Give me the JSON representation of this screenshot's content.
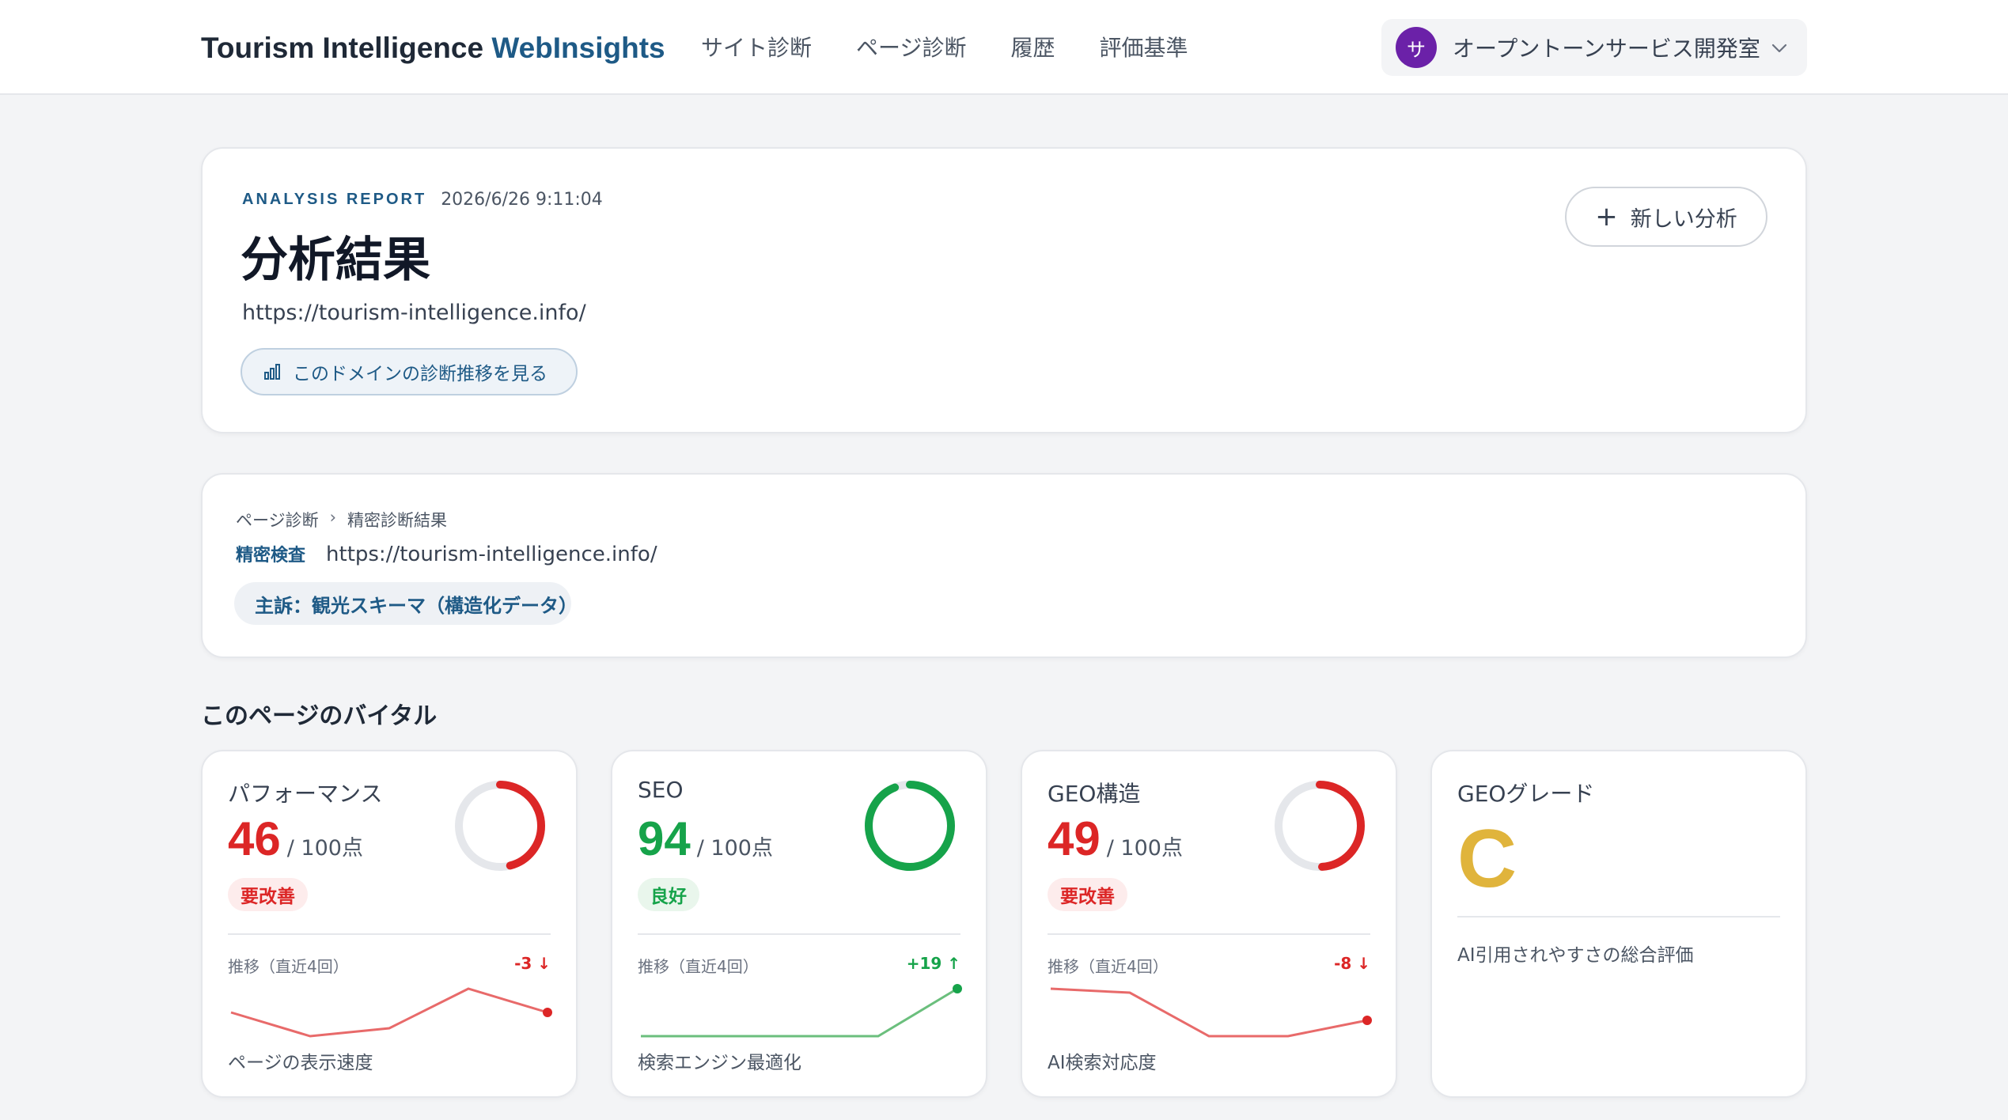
{
  "header": {
    "brand_main": "Tourism Intelligence ",
    "brand_accent": "WebInsights",
    "nav": [
      "サイト診断",
      "ページ診断",
      "履歴",
      "評価基準"
    ],
    "org": {
      "avatar": "サ",
      "name": "オープントーンサービス開発室"
    }
  },
  "report": {
    "kicker": "ANALYSIS REPORT",
    "date": "2026/6/26 9:11:04",
    "title": "分析結果",
    "url": "https://tourism-intelligence.info/",
    "trend_button": "このドメインの診断推移を見る",
    "new_button": "新しい分析"
  },
  "detail": {
    "breadcrumb": [
      "ページ診断",
      "›",
      "精密診断結果"
    ],
    "inspect_tag": "精密検査",
    "inspect_url": "https://tourism-intelligence.info/",
    "topic": "主訴：観光スキーマ（構造化データ）"
  },
  "section_title": "このページのバイタル",
  "vitals": [
    {
      "label": "パフォーマンス",
      "score": "46",
      "max": "/ 100点",
      "badge": "要改善",
      "status": "bad",
      "progress": 0.46,
      "trend_label": "推移（直近4回）",
      "delta": "-3 ↓",
      "trend": [
        46,
        43,
        44,
        49,
        46
      ],
      "desc": "ページの表示速度"
    },
    {
      "label": "SEO",
      "score": "94",
      "max": "/ 100点",
      "badge": "良好",
      "status": "good",
      "progress": 0.94,
      "trend_label": "推移（直近4回）",
      "delta": "+19 ↑",
      "trend": [
        75,
        75,
        75,
        75,
        94
      ],
      "desc": "検索エンジン最適化"
    },
    {
      "label": "GEO構造",
      "score": "49",
      "max": "/ 100点",
      "badge": "要改善",
      "status": "bad",
      "progress": 0.49,
      "trend_label": "推移（直近4回）",
      "delta": "-8 ↓",
      "trend": [
        57,
        56,
        45,
        45,
        49
      ],
      "desc": "AI検索対応度"
    }
  ],
  "grade_card": {
    "label": "GEOグレード",
    "grade": "C",
    "desc": "AI引用されやすさの総合評価"
  },
  "colors": {
    "accent": "#1e5a86",
    "bad": "#dc2626",
    "good": "#16a34a",
    "grade": "#e0b43c",
    "avatar": "#6b21a8"
  }
}
